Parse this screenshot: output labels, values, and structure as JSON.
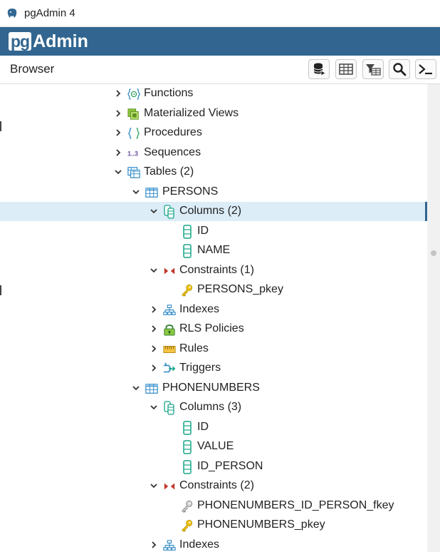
{
  "window": {
    "title": "pgAdmin 4"
  },
  "brand": {
    "pg": "pg",
    "admin": "Admin"
  },
  "browser": {
    "title": "Browser"
  },
  "toolbar": [
    {
      "name": "query-tool-button",
      "icon": "database-icon"
    },
    {
      "name": "view-data-button",
      "icon": "table-grid-icon"
    },
    {
      "name": "filtered-rows-button",
      "icon": "filter-table-icon"
    },
    {
      "name": "search-objects-button",
      "icon": "search-icon"
    },
    {
      "name": "psql-tool-button",
      "icon": "terminal-icon"
    }
  ],
  "tree": [
    {
      "label": "Functions",
      "icon": "functions-icon",
      "level": 0,
      "expanded": false
    },
    {
      "label": "Materialized Views",
      "icon": "materialized-views-icon",
      "level": 0,
      "expanded": false
    },
    {
      "label": "Procedures",
      "icon": "procedures-icon",
      "level": 0,
      "expanded": false
    },
    {
      "label": "Sequences",
      "icon": "sequences-icon",
      "level": 0,
      "expanded": false
    },
    {
      "label": "Tables (2)",
      "icon": "tables-icon",
      "level": 0,
      "expanded": true
    },
    {
      "label": "PERSONS",
      "icon": "table-icon",
      "level": 1,
      "expanded": true
    },
    {
      "label": "Columns (2)",
      "icon": "columns-icon",
      "level": 2,
      "expanded": true,
      "selected": true
    },
    {
      "label": "ID",
      "icon": "column-icon",
      "level": 3,
      "leaf": true
    },
    {
      "label": "NAME",
      "icon": "column-icon",
      "level": 3,
      "leaf": true
    },
    {
      "label": "Constraints (1)",
      "icon": "constraints-icon",
      "level": 2,
      "expanded": true
    },
    {
      "label": "PERSONS_pkey",
      "icon": "primary-key-icon",
      "level": 3,
      "leaf": true
    },
    {
      "label": "Indexes",
      "icon": "indexes-icon",
      "level": 2,
      "expanded": false
    },
    {
      "label": "RLS Policies",
      "icon": "rls-policies-icon",
      "level": 2,
      "expanded": false
    },
    {
      "label": "Rules",
      "icon": "rules-icon",
      "level": 2,
      "expanded": false
    },
    {
      "label": "Triggers",
      "icon": "triggers-icon",
      "level": 2,
      "expanded": false
    },
    {
      "label": "PHONENUMBERS",
      "icon": "table-icon",
      "level": 1,
      "expanded": true
    },
    {
      "label": "Columns (3)",
      "icon": "columns-icon",
      "level": 2,
      "expanded": true
    },
    {
      "label": "ID",
      "icon": "column-icon",
      "level": 3,
      "leaf": true
    },
    {
      "label": "VALUE",
      "icon": "column-icon",
      "level": 3,
      "leaf": true
    },
    {
      "label": "ID_PERSON",
      "icon": "column-icon",
      "level": 3,
      "leaf": true
    },
    {
      "label": "Constraints (2)",
      "icon": "constraints-icon",
      "level": 2,
      "expanded": true
    },
    {
      "label": "PHONENUMBERS_ID_PERSON_fkey",
      "icon": "foreign-key-icon",
      "level": 3,
      "leaf": true
    },
    {
      "label": "PHONENUMBERS_pkey",
      "icon": "primary-key-icon",
      "level": 3,
      "leaf": true
    },
    {
      "label": "Indexes",
      "icon": "indexes-icon",
      "level": 2,
      "expanded": false
    }
  ],
  "colors": {
    "brand": "#326690",
    "selected_row": "#dcedf8"
  }
}
